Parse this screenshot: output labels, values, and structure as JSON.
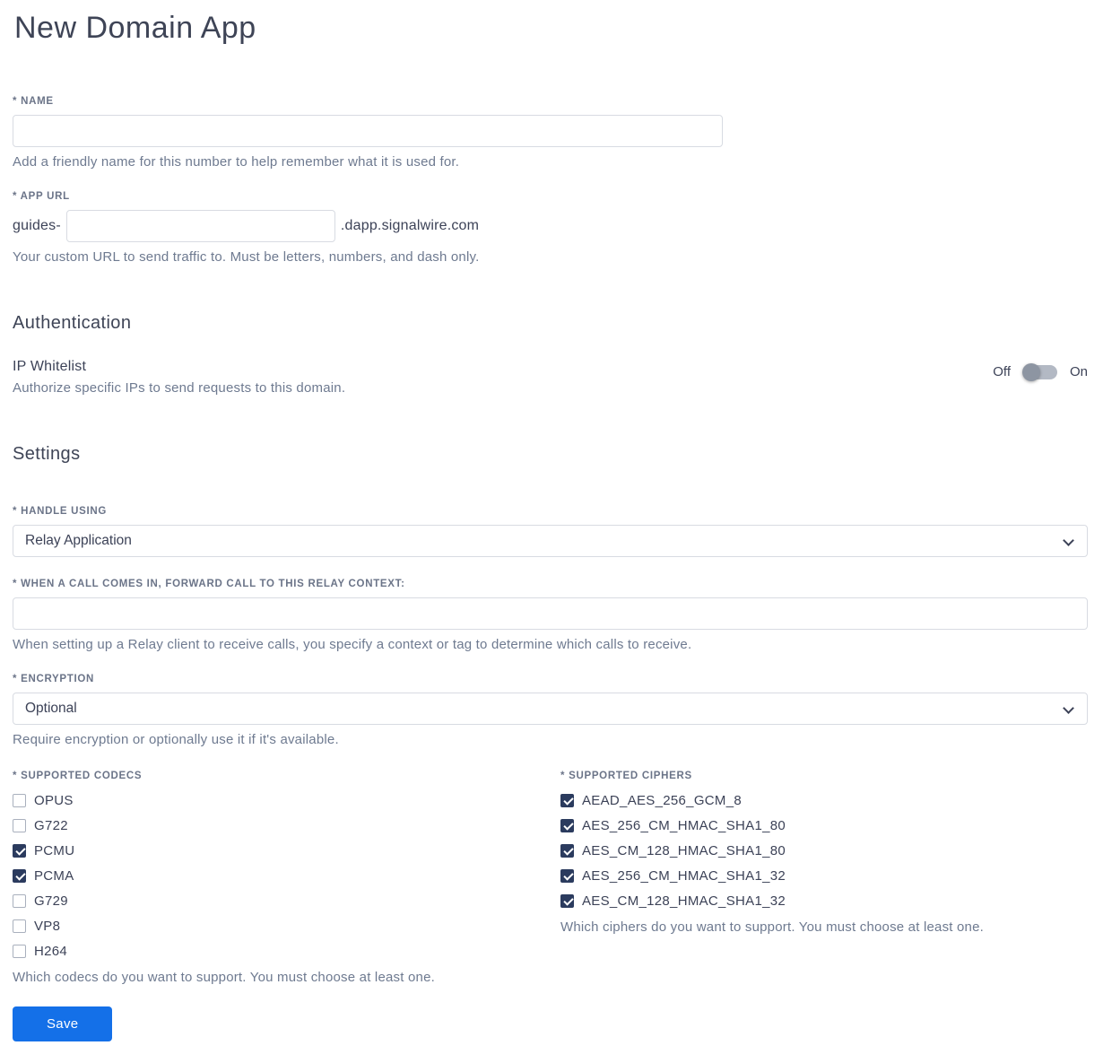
{
  "page": {
    "title": "New Domain App"
  },
  "name_field": {
    "label": "* NAME",
    "value": "",
    "helper": "Add a friendly name for this number to help remember what it is used for."
  },
  "app_url_field": {
    "label": "* APP URL",
    "prefix": "guides-",
    "value": "",
    "suffix": ".dapp.signalwire.com",
    "helper": "Your custom URL to send traffic to. Must be letters, numbers, and dash only."
  },
  "authentication": {
    "heading": "Authentication",
    "ip_whitelist": {
      "label": "IP Whitelist",
      "helper": "Authorize specific IPs to send requests to this domain.",
      "off_label": "Off",
      "on_label": "On",
      "state": "off"
    }
  },
  "settings": {
    "heading": "Settings",
    "handle_using": {
      "label": "* HANDLE USING",
      "value": "Relay Application"
    },
    "relay_context": {
      "label": "* WHEN A CALL COMES IN, FORWARD CALL TO THIS RELAY CONTEXT:",
      "value": "",
      "helper": "When setting up a Relay client to receive calls, you specify a context or tag to determine which calls to receive."
    },
    "encryption": {
      "label": "* ENCRYPTION",
      "value": "Optional",
      "helper": "Require encryption or optionally use it if it's available."
    },
    "codecs": {
      "label": "* SUPPORTED CODECS",
      "options": [
        {
          "label": "OPUS",
          "checked": false
        },
        {
          "label": "G722",
          "checked": false
        },
        {
          "label": "PCMU",
          "checked": true
        },
        {
          "label": "PCMA",
          "checked": true
        },
        {
          "label": "G729",
          "checked": false
        },
        {
          "label": "VP8",
          "checked": false
        },
        {
          "label": "H264",
          "checked": false
        }
      ],
      "helper": "Which codecs do you want to support. You must choose at least one."
    },
    "ciphers": {
      "label": "* SUPPORTED CIPHERS",
      "options": [
        {
          "label": "AEAD_AES_256_GCM_8",
          "checked": true
        },
        {
          "label": "AES_256_CM_HMAC_SHA1_80",
          "checked": true
        },
        {
          "label": "AES_CM_128_HMAC_SHA1_80",
          "checked": true
        },
        {
          "label": "AES_256_CM_HMAC_SHA1_32",
          "checked": true
        },
        {
          "label": "AES_CM_128_HMAC_SHA1_32",
          "checked": true
        }
      ],
      "helper": "Which ciphers do you want to support. You must choose at least one."
    }
  },
  "save_button": {
    "label": "Save"
  },
  "colors": {
    "accent": "#1470e8",
    "checkbox": "#2b3b5e",
    "toggle_track": "#b3b9c4",
    "toggle_knob": "#8d95a2"
  }
}
